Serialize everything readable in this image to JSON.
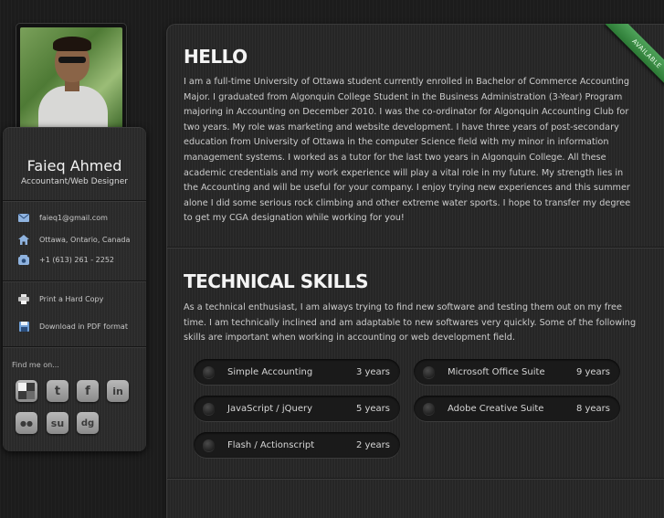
{
  "profile": {
    "name": "Faieq Ahmed",
    "role": "Accountant/Web Designer"
  },
  "contact": {
    "email": "faieq1@gmail.com",
    "location": "Ottawa, Ontario, Canada",
    "phone": "+1 (613) 261 - 2252"
  },
  "actions": {
    "print": "Print a Hard Copy",
    "download": "Download in PDF format"
  },
  "social": {
    "heading": "Find me on...",
    "items": [
      {
        "icon": "delicious-icon",
        "glyph": "▚"
      },
      {
        "icon": "twitter-icon",
        "glyph": "t"
      },
      {
        "icon": "facebook-icon",
        "glyph": "f"
      },
      {
        "icon": "linkedin-icon",
        "glyph": "in"
      },
      {
        "icon": "flickr-icon",
        "glyph": "●●"
      },
      {
        "icon": "stumbleupon-icon",
        "glyph": "su"
      },
      {
        "icon": "digg-icon",
        "glyph": "dg"
      }
    ]
  },
  "ribbon": {
    "label": "AVAILABLE"
  },
  "hello": {
    "title": "HELLO",
    "text": "I am a full-time University of Ottawa student currently enrolled in Bachelor of Commerce Accounting Major. I graduated from Algonquin College Student in the Business Administration (3-Year) Program majoring in Accounting on December 2010. I was the co-ordinator for Algonquin Accounting Club for two years. My role was marketing and website development. I have three years of post-secondary education from University of Ottawa in the computer Science field with my minor in information management systems. I worked as a tutor for the last two years in Algonquin College. All these academic credentials and my work experience will play a vital role in my future. My strength lies in the Accounting and will be useful for your company. I enjoy trying new experiences and this summer alone I did some serious rock climbing and other extreme water sports. I hope to transfer my degree to get my CGA designation while working for you!"
  },
  "skills": {
    "title": "TECHNICAL SKILLS",
    "intro": "As a technical enthusiast, I am always trying to find new software and testing them out on my free time. I am technically inclined and am adaptable to new softwares very quickly. Some of the following skills are important when working in accounting or web development field.",
    "items": [
      {
        "name": "Simple Accounting",
        "years": "3 years"
      },
      {
        "name": "Microsoft Office Suite",
        "years": "9 years"
      },
      {
        "name": "JavaScript / jQuery",
        "years": "5 years"
      },
      {
        "name": "Adobe Creative Suite",
        "years": "8 years"
      },
      {
        "name": "Flash / Actionscript",
        "years": "2 years"
      }
    ]
  },
  "colors": {
    "background": "#1c1c1c",
    "panel": "#262626",
    "ribbon": "#3a8f44"
  }
}
